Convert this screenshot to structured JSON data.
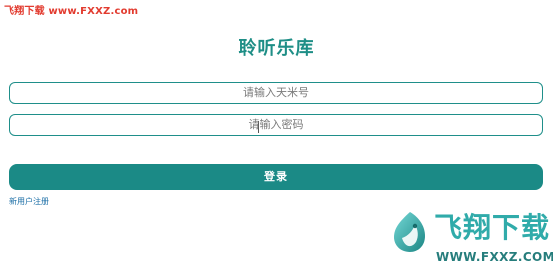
{
  "watermark_top": "飞翔下载 www.FXXZ.com",
  "title": "聆听乐库",
  "inputs": {
    "account": {
      "placeholder": "请输入天米号"
    },
    "password": {
      "placeholder": "请输入密码"
    }
  },
  "login_button": {
    "label": "登录"
  },
  "register_link": {
    "label": "新用户注册"
  },
  "brand_watermark": {
    "cn": "飞翔下载",
    "url": "WWW.FXXZ.COM"
  },
  "colors": {
    "accent": "#1b8a86",
    "title": "#1e8e86",
    "input_border": "#1f8f8a",
    "watermark_red": "#e23b2f",
    "link_blue": "#1b6ea6"
  },
  "icons": {
    "brand_logo": "fxxz-bird-logo-icon"
  }
}
